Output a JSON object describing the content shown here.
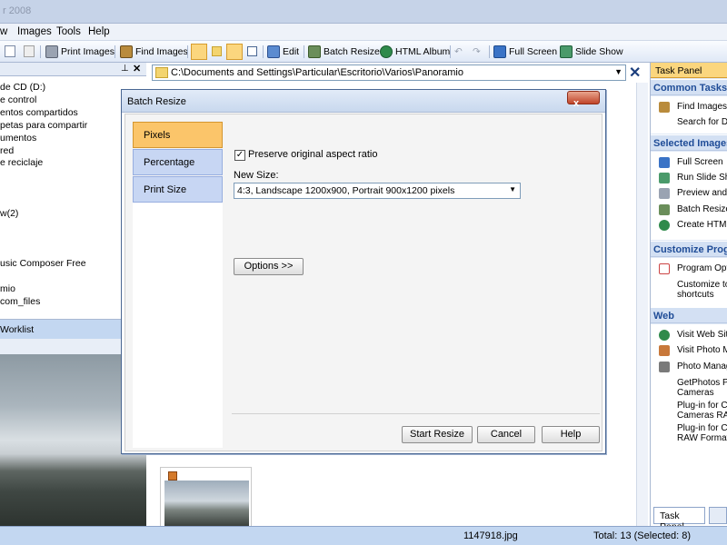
{
  "window": {
    "title": "r 2008"
  },
  "menu": [
    "w",
    "Images",
    "Tools",
    "Help"
  ],
  "toolbar": {
    "print": "Print Images",
    "find": "Find Images",
    "edit": "Edit",
    "batch_resize": "Batch Resize",
    "html_album": "HTML Album",
    "full_screen": "Full Screen",
    "slide_show": "Slide Show"
  },
  "left_pane": {
    "tree": [
      "de CD (D:)",
      "e control",
      "entos compartidos",
      "petas para compartir",
      "umentos",
      "red",
      "e reciclaje",
      "w(2)",
      "usic Composer Free",
      "mio",
      "com_files"
    ],
    "worklist_label": "Worklist"
  },
  "address": {
    "path": "C:\\Documents and Settings\\Particular\\Escritorio\\Varios\\Panoramio"
  },
  "task_panel": {
    "title": "Task Panel",
    "sections": [
      {
        "title": "Common Tasks",
        "items": [
          "Find Images",
          "Search for Du"
        ]
      },
      {
        "title": "Selected Images",
        "items": [
          "Full Screen",
          "Run Slide Sho",
          "Preview and P",
          "Batch Resize",
          "Create HTML"
        ]
      },
      {
        "title": "Customize Progra",
        "items": [
          "Program Optio",
          "Customize too",
          "shortcuts"
        ]
      },
      {
        "title": "Web",
        "items": [
          "Visit Web Site",
          "Visit Photo Ma",
          "Photo Manage",
          "GetPhotos Plu",
          "Cameras",
          "Plug-in for Ca",
          "Cameras RAW",
          "Plug-in for Ca",
          "RAW Format"
        ]
      }
    ],
    "tab_label": "Task Panel"
  },
  "status": {
    "filename": "1147918.jpg",
    "total": "Total: 13 (Selected: 8)"
  },
  "dialog": {
    "title": "Batch Resize",
    "tabs": [
      "Pixels",
      "Percentage",
      "Print Size"
    ],
    "preserve_label": "Preserve original aspect ratio",
    "preserve_checked": true,
    "new_size_label": "New Size:",
    "new_size_value": "4:3, Landscape 1200x900, Portrait 900x1200 pixels",
    "options_button": "Options >>",
    "start_button": "Start Resize",
    "cancel_button": "Cancel",
    "help_button": "Help",
    "close_glyph": "x"
  }
}
